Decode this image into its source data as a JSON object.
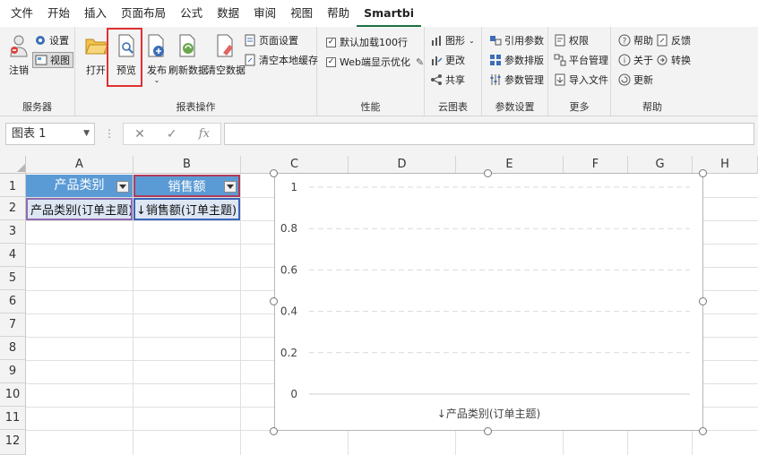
{
  "menu": [
    "文件",
    "开始",
    "插入",
    "页面布局",
    "公式",
    "数据",
    "审阅",
    "视图",
    "帮助",
    "Smartbi"
  ],
  "ribbon": {
    "server": {
      "label": "服务器",
      "logout": "注销",
      "settings": "设置",
      "view": "视图"
    },
    "report": {
      "label": "报表操作",
      "open": "打开",
      "preview": "预览",
      "publish": "发布",
      "refresh": "刷新数据",
      "clear": "清空数据",
      "page_setup": "页面设置",
      "clear_cache": "清空本地缓存"
    },
    "perf": {
      "label": "性能",
      "default_load": "默认加载100行",
      "web_optimize": "Web端显示优化"
    },
    "cloud": {
      "label": "云图表",
      "chart": "图形",
      "change": "更改",
      "share": "共享"
    },
    "params": {
      "label": "参数设置",
      "ref": "引用参数",
      "layout": "参数排版",
      "manage": "参数管理"
    },
    "more": {
      "label": "更多",
      "perm": "权限",
      "platform": "平台管理",
      "import": "导入文件"
    },
    "help": {
      "label": "帮助",
      "help": "帮助",
      "feedback": "反馈",
      "about": "关于",
      "convert": "转换",
      "update": "更新"
    }
  },
  "formula_bar": {
    "name_box": "图表 1",
    "cancel": "✕",
    "enter": "✓",
    "fx": "fx",
    "value": ""
  },
  "columns": [
    "A",
    "B",
    "C",
    "D",
    "E",
    "F",
    "G",
    "H"
  ],
  "rows": [
    "1",
    "2",
    "3",
    "4",
    "5",
    "6",
    "7",
    "8",
    "9",
    "10",
    "11",
    "12"
  ],
  "cells": {
    "a1": "产品类别",
    "b1": "销售额",
    "a2": "产品类别(订单主题)",
    "b2": "↓销售额(订单主题)"
  },
  "chart_data": {
    "type": "bar",
    "categories": [],
    "values": [],
    "yticks": [
      "1",
      "0.8",
      "0.6",
      "0.4",
      "0.2",
      "0"
    ],
    "ylim": [
      0,
      1
    ],
    "xlabel": "↓产品类别(订单主题)",
    "grid": true
  }
}
